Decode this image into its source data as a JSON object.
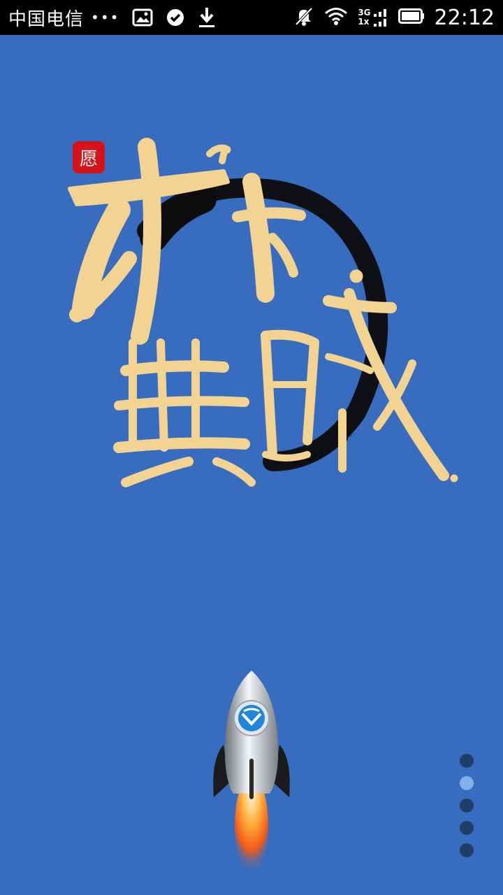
{
  "status_bar": {
    "carrier": "中国电信",
    "more": "•••",
    "network_top": "3G",
    "network_bottom": "1x",
    "time": "22:12",
    "icons": [
      "image-icon",
      "check-circle-icon",
      "download-icon",
      "mute-icon",
      "wifi-icon",
      "signal-icon",
      "battery-icon"
    ]
  },
  "splash": {
    "seal_text": "愿",
    "calligraphy_text": "天下無賊",
    "colors": {
      "background": "#376cbf",
      "gold": "#f3d391",
      "ink": "#0c0c0c",
      "seal": "#d6121a"
    }
  },
  "pager": {
    "count": 5,
    "active_index": 1
  }
}
